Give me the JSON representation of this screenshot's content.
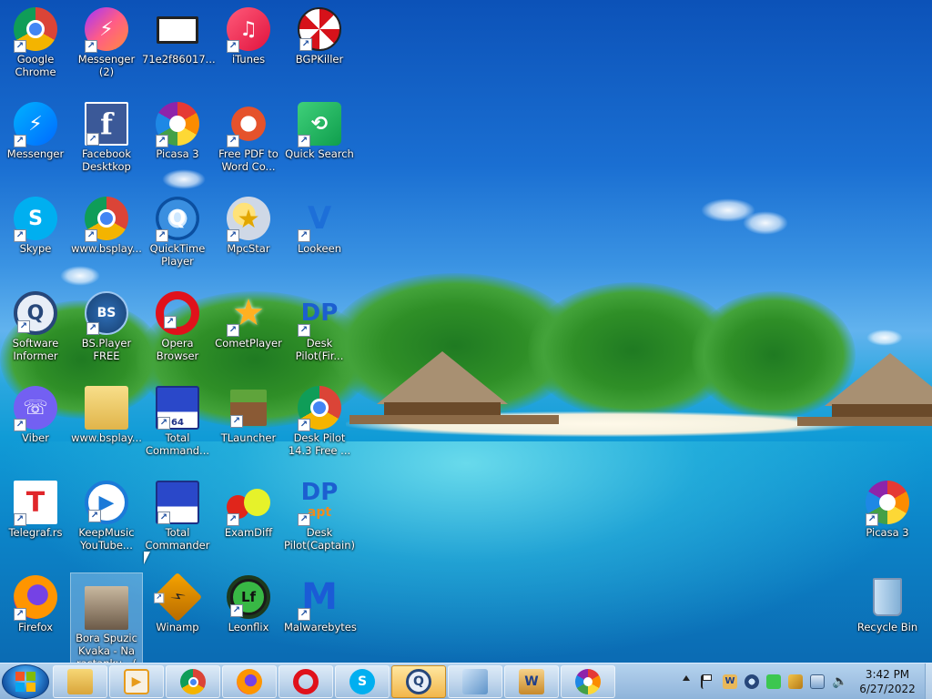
{
  "desktop": {
    "icons": [
      {
        "label": "Google Chrome",
        "icon": "chrome-icon"
      },
      {
        "label": "Messenger (2)",
        "icon": "messenger-icon"
      },
      {
        "label": "71e2f86017...",
        "icon": "image-file-icon"
      },
      {
        "label": "iTunes",
        "icon": "itunes-icon"
      },
      {
        "label": "BGPKiller",
        "icon": "umbrella-icon"
      },
      {
        "label": "Messenger",
        "icon": "messenger-icon"
      },
      {
        "label": "Facebook Desktkop",
        "icon": "facebook-icon"
      },
      {
        "label": "Picasa 3",
        "icon": "picasa-icon"
      },
      {
        "label": "Free PDF to Word Co...",
        "icon": "pdf-converter-icon"
      },
      {
        "label": "Quick Search",
        "icon": "quick-search-icon"
      },
      {
        "label": "Skype",
        "icon": "skype-icon"
      },
      {
        "label": "www.bsplay...",
        "icon": "chrome-icon"
      },
      {
        "label": "QuickTime Player",
        "icon": "quicktime-icon"
      },
      {
        "label": "MpcStar",
        "icon": "mpcstar-icon"
      },
      {
        "label": "Lookeen",
        "icon": "lookeen-icon"
      },
      {
        "label": "Software Informer",
        "icon": "software-informer-icon"
      },
      {
        "label": "BS.Player FREE",
        "icon": "bsplayer-icon"
      },
      {
        "label": "Opera Browser",
        "icon": "opera-icon"
      },
      {
        "label": "CometPlayer",
        "icon": "cometplayer-icon"
      },
      {
        "label": "Desk Pilot(Fir...",
        "icon": "deskpilot-icon"
      },
      {
        "label": "Viber",
        "icon": "viber-icon"
      },
      {
        "label": "www.bsplay...",
        "icon": "folder-icon"
      },
      {
        "label": "Total Command...",
        "icon": "floppy-icon"
      },
      {
        "label": "TLauncher",
        "icon": "minecraft-icon"
      },
      {
        "label": "Desk Pilot 14.3 Free ...",
        "icon": "chrome-icon"
      },
      {
        "label": "Telegraf.rs",
        "icon": "telegraf-icon"
      },
      {
        "label": "KeepMusic YouTube...",
        "icon": "keepmusic-icon"
      },
      {
        "label": "Total Commander",
        "icon": "floppy-icon"
      },
      {
        "label": "ExamDiff",
        "icon": "examdiff-icon"
      },
      {
        "label": "Desk Pilot(Captain)",
        "icon": "deskpilot-icon"
      },
      {
        "label": "Firefox",
        "icon": "firefox-icon"
      },
      {
        "label": "Bora Spuzic Kvaka - Na rastanku - (",
        "icon": "video-file-icon"
      },
      {
        "label": "Winamp",
        "icon": "winamp-icon"
      },
      {
        "label": "Leonflix",
        "icon": "leonflix-icon"
      },
      {
        "label": "Malwarebytes",
        "icon": "malwarebytes-icon"
      },
      {
        "label": "Picasa 3",
        "icon": "picasa-icon"
      },
      {
        "label": "Recycle Bin",
        "icon": "recycle-bin-icon"
      }
    ]
  },
  "taskbar": {
    "start": {
      "icon": "windows-logo-icon"
    },
    "apps": [
      {
        "icon": "file-explorer-icon",
        "active": false
      },
      {
        "icon": "media-player-icon",
        "active": false
      },
      {
        "icon": "chrome-icon",
        "active": false
      },
      {
        "icon": "firefox-icon",
        "active": false
      },
      {
        "icon": "opera-icon",
        "active": false
      },
      {
        "icon": "skype-icon",
        "active": false
      },
      {
        "icon": "software-informer-icon",
        "active": true
      },
      {
        "icon": "control-panel-icon",
        "active": false
      },
      {
        "icon": "word-icon",
        "active": false
      },
      {
        "icon": "picasa-icon",
        "active": false
      }
    ],
    "tray_icons": [
      "chevron-up-icon",
      "flag-icon",
      "word-icon",
      "quicktime-icon",
      "green-app-icon",
      "tool-icon",
      "network-icon",
      "speaker-icon"
    ],
    "clock": {
      "time": "3:42 PM",
      "date": "6/27/2022"
    }
  }
}
